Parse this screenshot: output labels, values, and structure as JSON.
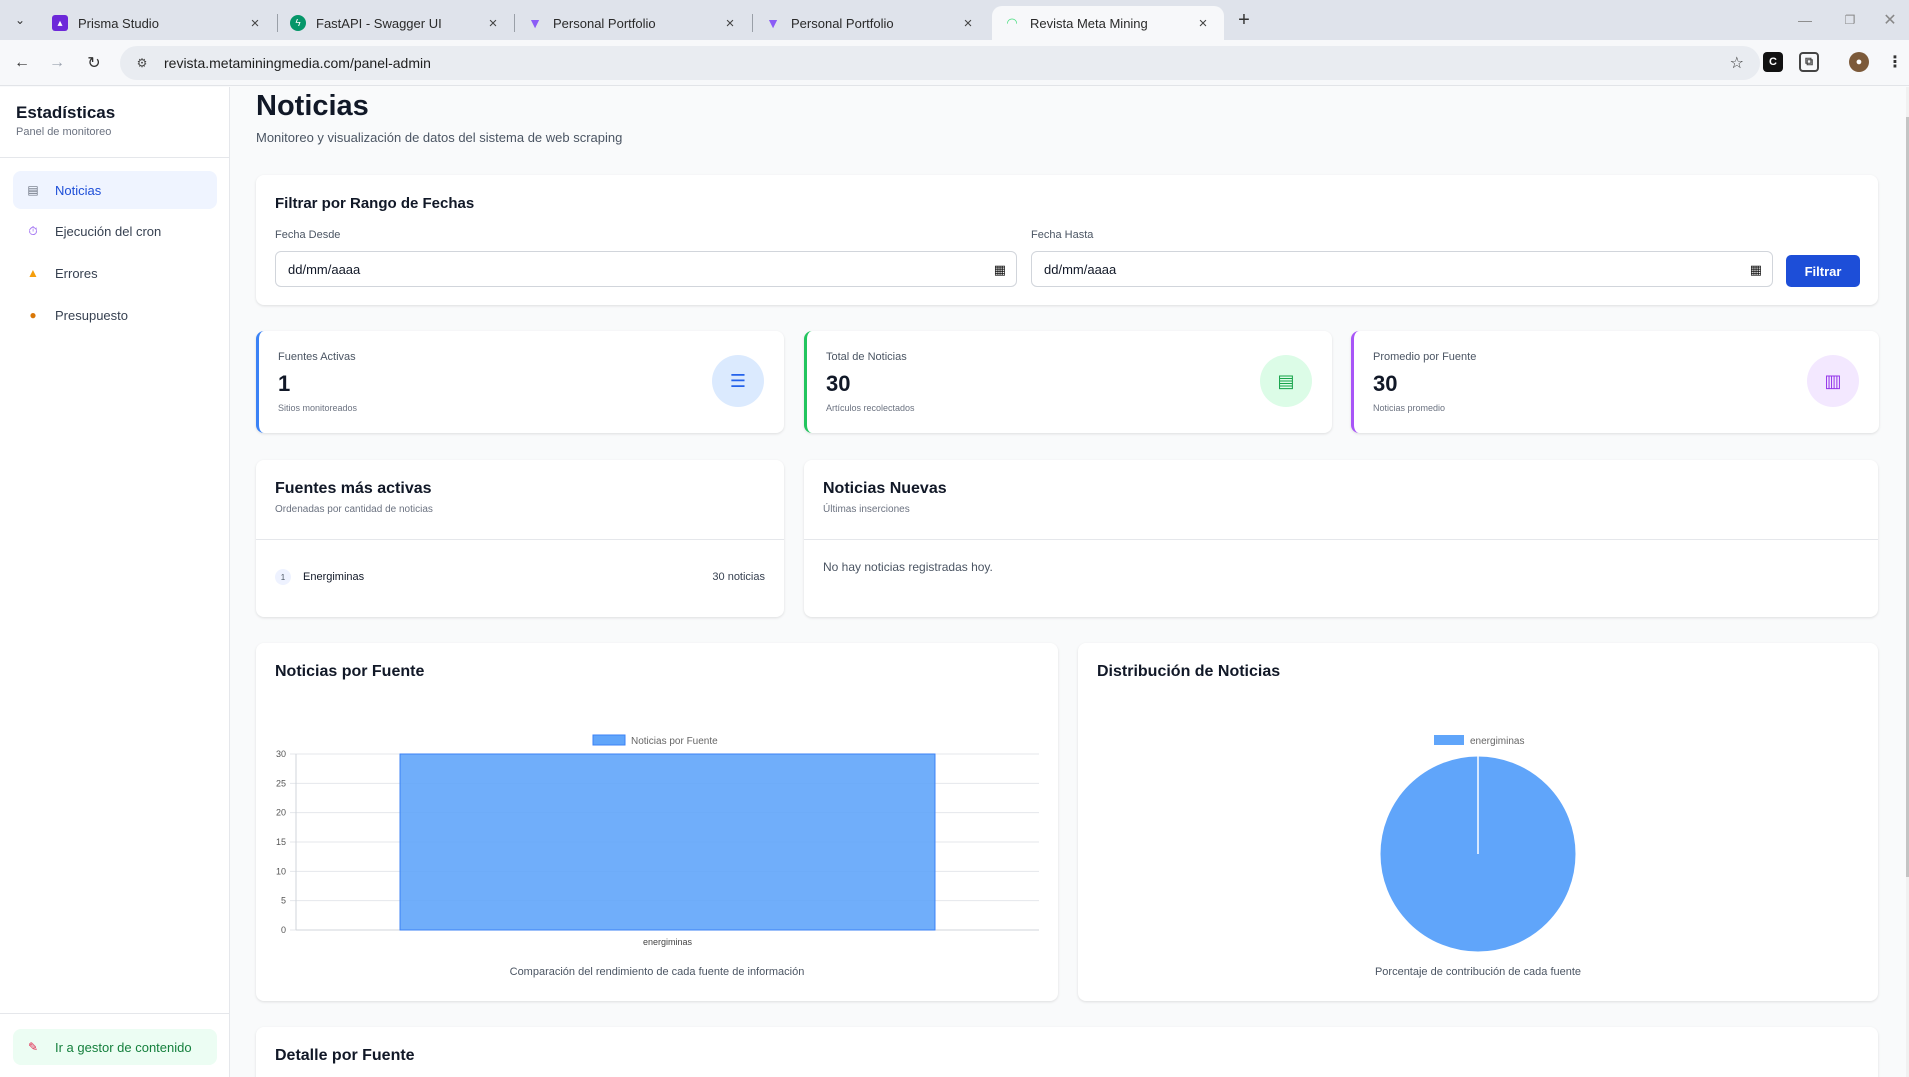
{
  "browser": {
    "tabs": [
      {
        "title": "Prisma Studio",
        "favicon": "prisma-icon"
      },
      {
        "title": "FastAPI - Swagger UI",
        "favicon": "fastapi-icon"
      },
      {
        "title": "Personal Portfolio",
        "favicon": "vite-icon"
      },
      {
        "title": "Personal Portfolio",
        "favicon": "vite-icon"
      },
      {
        "title": "Revista Meta Mining",
        "favicon": "wifi-icon"
      }
    ],
    "active_tab": 4,
    "url": "revista.metaminingmedia.com/panel-admin"
  },
  "sidebar": {
    "title": "Estadísticas",
    "subtitle": "Panel de monitoreo",
    "items": [
      {
        "label": "Noticias",
        "icon": "newspaper-icon"
      },
      {
        "label": "Ejecución del cron",
        "icon": "stopwatch-icon"
      },
      {
        "label": "Errores",
        "icon": "warning-icon"
      },
      {
        "label": "Presupuesto",
        "icon": "money-bag-icon"
      }
    ],
    "cms_link": "Ir a gestor de contenido"
  },
  "header": {
    "title": "Noticias",
    "subtitle": "Monitoreo y visualización de datos del sistema de web scraping"
  },
  "filter": {
    "title": "Filtrar por Rango de Fechas",
    "from_label": "Fecha Desde",
    "to_label": "Fecha Hasta",
    "from_placeholder": "dd/mm/aaaa",
    "to_placeholder": "dd/mm/aaaa",
    "button": "Filtrar"
  },
  "stats": [
    {
      "label": "Fuentes Activas",
      "value": "1",
      "sub": "Sitios monitoreados",
      "color": "#3b82f6"
    },
    {
      "label": "Total de Noticias",
      "value": "30",
      "sub": "Artículos recolectados",
      "color": "#22c55e"
    },
    {
      "label": "Promedio por Fuente",
      "value": "30",
      "sub": "Noticias promedio",
      "color": "#a855f7"
    }
  ],
  "top_sources": {
    "title": "Fuentes más activas",
    "subtitle": "Ordenadas por cantidad de noticias",
    "rows": [
      {
        "rank": "1",
        "name": "Energiminas",
        "count": "30 noticias"
      }
    ]
  },
  "new_news": {
    "title": "Noticias Nuevas",
    "subtitle": "Últimas inserciones",
    "empty": "No hay noticias registradas hoy."
  },
  "bar_card": {
    "title": "Noticias por Fuente",
    "caption": "Comparación del rendimiento de cada fuente de información"
  },
  "pie_card": {
    "title": "Distribución de Noticias",
    "caption": "Porcentaje de contribución de cada fuente"
  },
  "detail": {
    "title": "Detalle por Fuente"
  },
  "chart_data": [
    {
      "type": "bar",
      "categories": [
        "energiminas"
      ],
      "series": [
        {
          "name": "Noticias por Fuente",
          "values": [
            30
          ]
        }
      ],
      "ylim": [
        0,
        30
      ],
      "yticks": [
        0,
        5,
        10,
        15,
        20,
        25,
        30
      ],
      "color": "#60a5fa",
      "legend": "top"
    },
    {
      "type": "pie",
      "labels": [
        "energiminas"
      ],
      "values": [
        30
      ],
      "color": "#60a5fa",
      "legend": "top"
    }
  ]
}
